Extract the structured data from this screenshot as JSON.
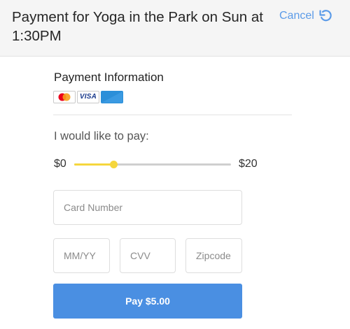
{
  "header": {
    "title": "Payment for Yoga in the Park on Sun at 1:30PM",
    "cancel_label": "Cancel",
    "cancel_icon": "undo-icon"
  },
  "payment": {
    "section_title": "Payment Information",
    "card_icons": [
      "mastercard-icon",
      "visa-icon",
      "amex-icon"
    ],
    "visa_text": "VISA"
  },
  "amount": {
    "prompt": "I would like to pay:",
    "min_label": "$0",
    "max_label": "$20",
    "min": 0,
    "max": 20,
    "value": 5
  },
  "form": {
    "card_number_placeholder": "Card Number",
    "expiry_placeholder": "MM/YY",
    "cvv_placeholder": "CVV",
    "zip_placeholder": "Zipcode"
  },
  "pay_button_label": "Pay $5.00",
  "colors": {
    "accent": "#4a8fe2",
    "link": "#5b9be8",
    "slider": "#f5d63d"
  }
}
